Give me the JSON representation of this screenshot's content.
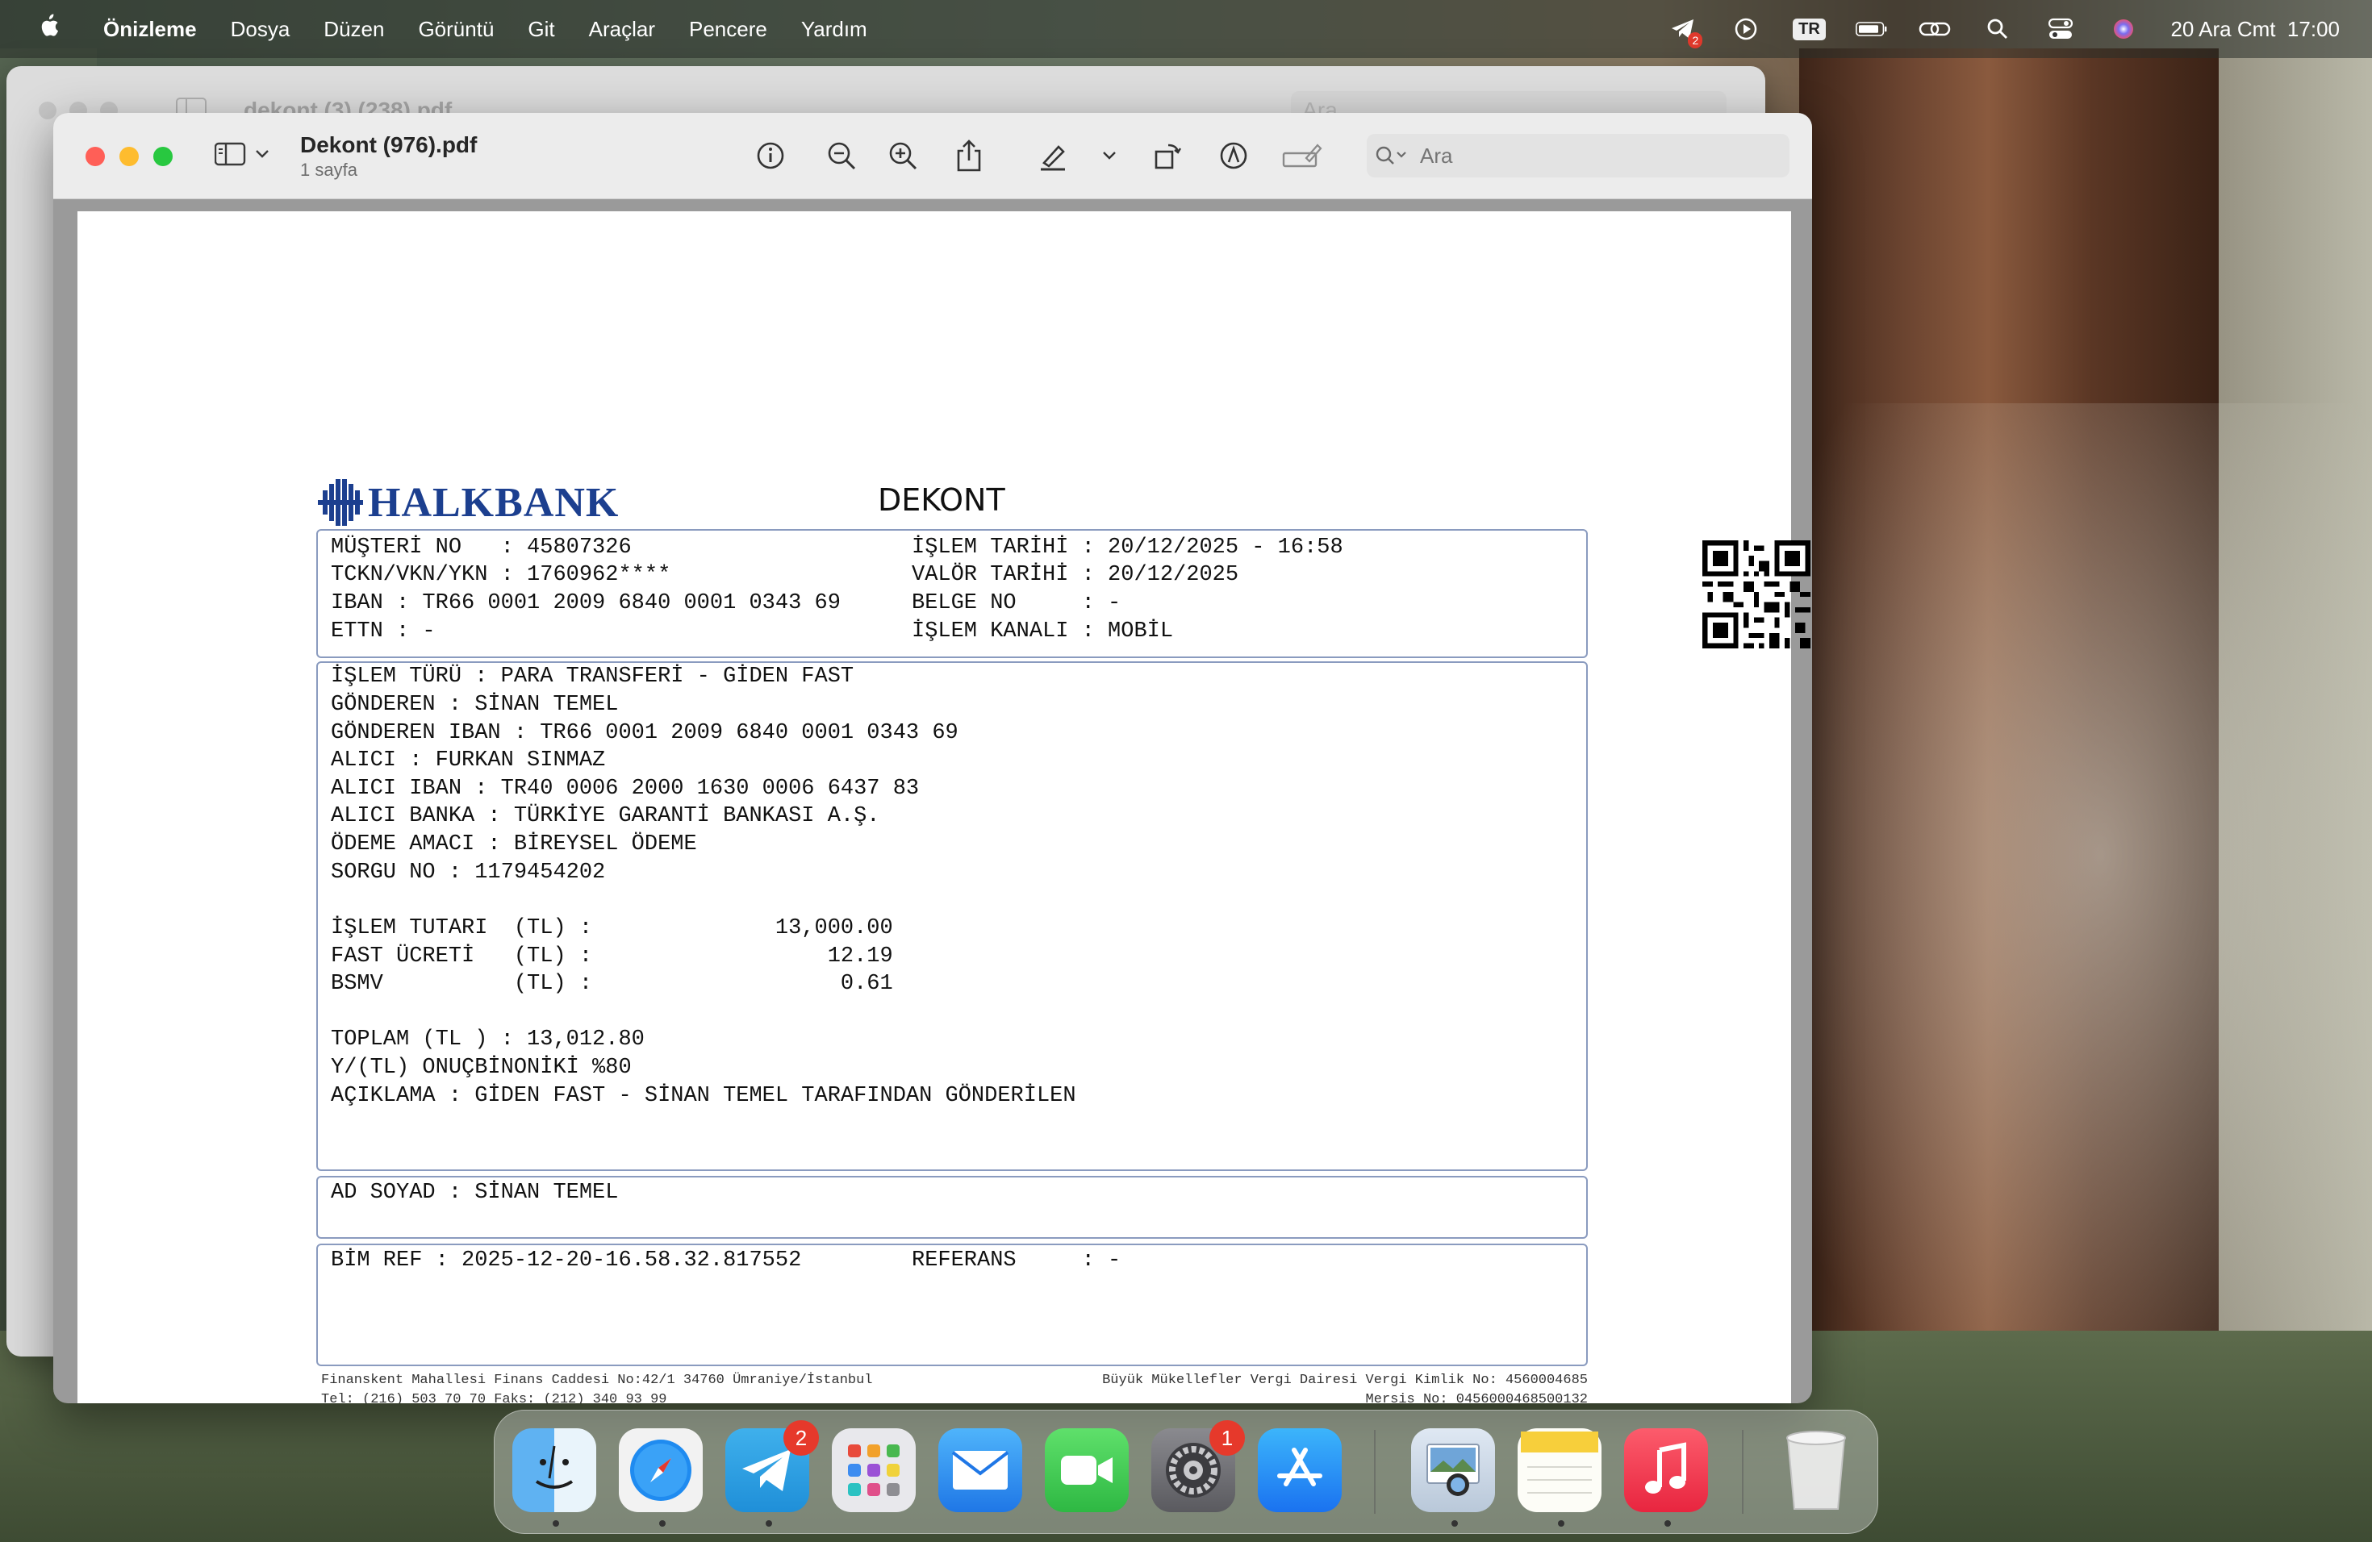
{
  "menubar": {
    "app_name": "Önizleme",
    "items": [
      "Dosya",
      "Düzen",
      "Görüntü",
      "Git",
      "Araçlar",
      "Pencere",
      "Yardım"
    ],
    "keyboard_layout": "TR",
    "telegram_badge": "2",
    "datetime": "20 Ara Cmt  17:00",
    "icons": [
      "apple-icon",
      "telegram-icon",
      "play-icon",
      "battery-icon",
      "link-icon",
      "search-icon",
      "control-center-icon",
      "siri-icon"
    ]
  },
  "back_window": {
    "title": "dekont (3) (238).pdf",
    "search_placeholder": "Ara"
  },
  "window": {
    "title": "Dekont (976).pdf",
    "subtitle": "1 sayfa",
    "search_placeholder": "Ara",
    "tools": [
      "info-icon",
      "zoom-out-icon",
      "zoom-in-icon",
      "share-icon",
      "highlight-icon",
      "chevron-down-icon",
      "rotate-icon",
      "markup-icon",
      "form-fill-icon"
    ]
  },
  "document": {
    "bank_name": "HALKBANK",
    "title": "DEKONT",
    "header_left": [
      "MÜŞTERİ NO   : 45807326",
      "TCKN/VKN/YKN : 1760962****",
      "IBAN : TR66 0001 2009 6840 0001 0343 69",
      "ETTN : -"
    ],
    "header_right": [
      "İŞLEM TARİHİ : 20/12/2025 - 16:58",
      "VALÖR TARİHİ : 20/12/2025",
      "BELGE NO     : -",
      "İŞLEM KANALI : MOBİL"
    ],
    "details": [
      "İŞLEM TÜRÜ : PARA TRANSFERİ - GİDEN FAST",
      "GÖNDEREN : SİNAN TEMEL",
      "GÖNDEREN IBAN : TR66 0001 2009 6840 0001 0343 69",
      "ALICI : FURKAN SINMAZ",
      "ALICI IBAN : TR40 0006 2000 1630 0006 6437 83",
      "ALICI BANKA : TÜRKİYE GARANTİ BANKASI A.Ş.",
      "ÖDEME AMACI : BİREYSEL ÖDEME",
      "SORGU NO : 1179454202",
      "",
      "İŞLEM TUTARI  (TL) :              13,000.00",
      "FAST ÜCRETİ   (TL) :                  12.19",
      "BSMV          (TL) :                   0.61",
      "",
      "TOPLAM (TL ) : 13,012.80",
      "Y/(TL) ONUÇBİNONİKİ %80",
      "AÇIKLAMA : GİDEN FAST - SİNAN TEMEL TARAFINDAN GÖNDERİLEN"
    ],
    "name_line": "AD SOYAD : SİNAN TEMEL",
    "ref_left": "BİM REF : 2025-12-20-16.58.32.817552",
    "ref_right": "REFERANS     : -",
    "footer_left_1": "Finanskent Mahallesi Finans Caddesi No:42/1 34760 Ümraniye/İstanbul",
    "footer_left_2": "Tel: (216) 503 70 70 Faks: (212) 340 93 99",
    "footer_right_1": "Büyük Mükellefler Vergi Dairesi Vergi Kimlik No: 4560004685",
    "footer_right_2": "Mersis No: 0456000468500132"
  },
  "dock": {
    "apps": [
      {
        "name": "Finder",
        "icon": "finder-icon",
        "running": true
      },
      {
        "name": "Safari",
        "icon": "safari-icon",
        "running": true
      },
      {
        "name": "Telegram",
        "icon": "telegram-icon",
        "badge": "2",
        "running": true
      },
      {
        "name": "Launchpad",
        "icon": "launchpad-icon",
        "running": false
      },
      {
        "name": "Mail",
        "icon": "mail-icon",
        "running": false
      },
      {
        "name": "FaceTime",
        "icon": "facetime-icon",
        "running": false
      },
      {
        "name": "System Settings",
        "icon": "settings-icon",
        "badge": "1",
        "running": false
      },
      {
        "name": "App Store",
        "icon": "app-store-icon",
        "running": false
      },
      {
        "name": "Preview",
        "icon": "preview-icon",
        "running": true
      },
      {
        "name": "Notes",
        "icon": "notes-icon",
        "running": true
      },
      {
        "name": "Music",
        "icon": "music-icon",
        "running": true
      },
      {
        "name": "Trash",
        "icon": "trash-icon",
        "running": false
      }
    ]
  }
}
